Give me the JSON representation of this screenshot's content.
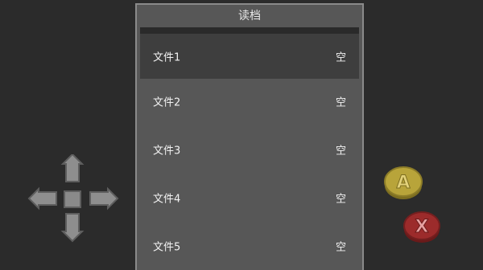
{
  "dialog": {
    "title": "读档",
    "slots": [
      {
        "name": "文件1",
        "status": "空",
        "selected": true
      },
      {
        "name": "文件2",
        "status": "空",
        "selected": false
      },
      {
        "name": "文件3",
        "status": "空",
        "selected": false
      },
      {
        "name": "文件4",
        "status": "空",
        "selected": false
      },
      {
        "name": "文件5",
        "status": "空",
        "selected": false
      }
    ]
  },
  "controls": {
    "a_button_label": "A",
    "x_button_label": "X",
    "a_color": "#b8a43a",
    "x_color": "#9c2b2b"
  }
}
